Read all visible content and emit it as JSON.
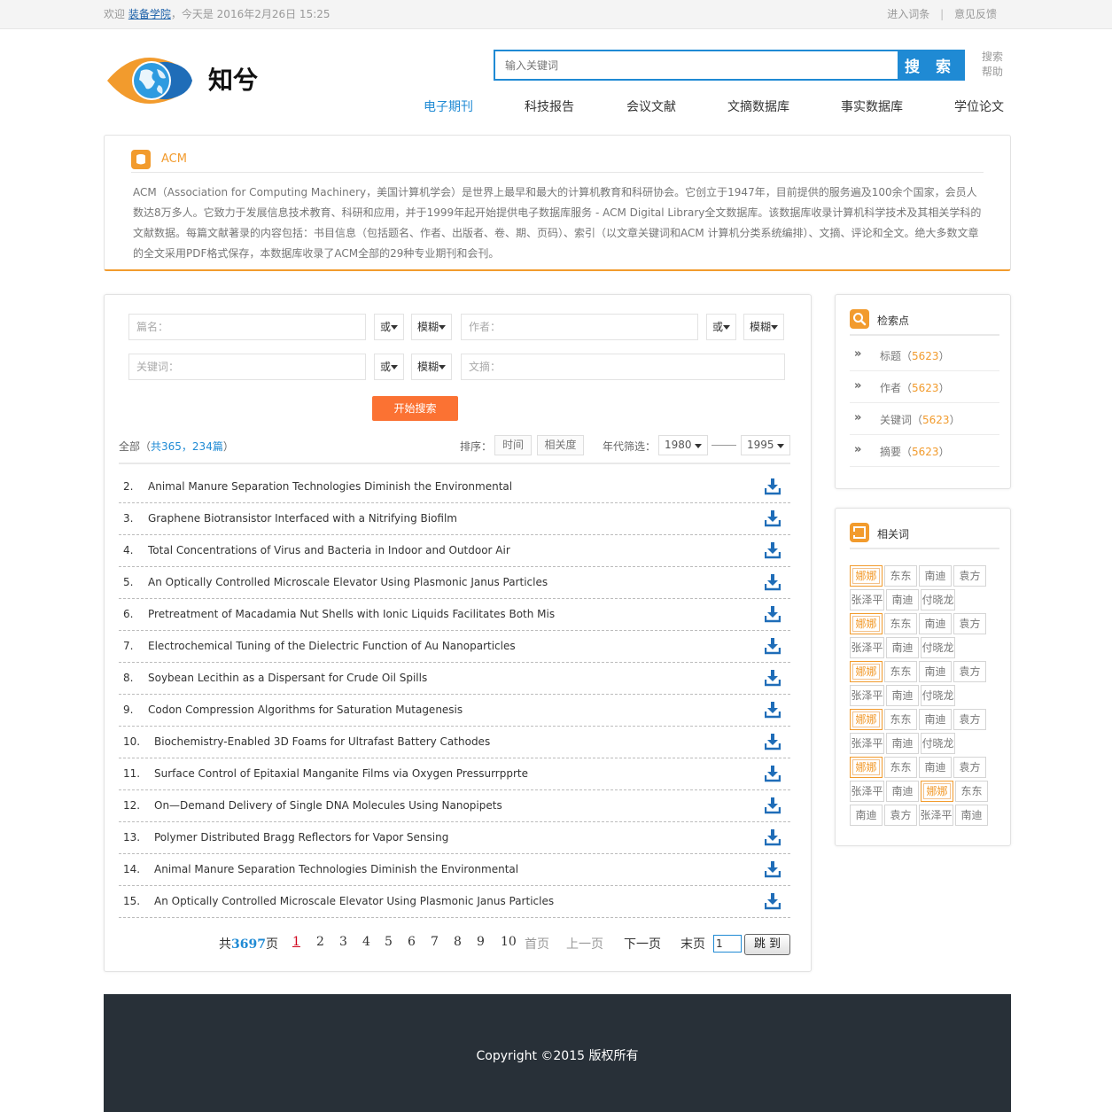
{
  "topbar": {
    "welcome_prefix": "欢迎",
    "org": "装备学院",
    "date_text": "，今天是 2016年2月26日  15:25",
    "login_link": "进入词条",
    "feedback_link": "意见反馈"
  },
  "header": {
    "logo_text": "知兮",
    "search_placeholder": "输入关键词",
    "search_button": "搜 索",
    "help_line1": "搜索",
    "help_line2": "帮助"
  },
  "nav": [
    "电子期刊",
    "科技报告",
    "会议文献",
    "文摘数据库",
    "事实数据库",
    "学位论文"
  ],
  "intro": {
    "name": "ACM",
    "description": "ACM（Association for Computing Machinery，美国计算机学会）是世界上最早和最大的计算机教育和科研协会。它创立于1947年，目前提供的服务遍及100余个国家，会员人数达8万多人。它致力于发展信息技术教育、科研和应用，并于1999年起开始提供电子数据库服务 - ACM Digital Library全文数据库。该数据库收录计算机科学技术及其相关学科的文献数据。每篇文献著录的内容包括：书目信息（包括题名、作者、出版者、卷、期、页码）、索引（以文章关键词和ACM 计算机分类系统编排）、文摘、评论和全文。绝大多数文章的全文采用PDF格式保存，本数据库收录了ACM全部的29种专业期刊和会刊。"
  },
  "search_form": {
    "title_ph": "篇名：",
    "author_ph": "作者：",
    "keyword_ph": "关键词：",
    "abstract_ph": "文摘：",
    "logic": "或",
    "match": "模糊",
    "start_button": "开始搜索"
  },
  "results": {
    "all_label": "全部（",
    "total": "共365，234篇",
    "all_close": "）",
    "sort_label": "排序：",
    "sort_time": "时间",
    "sort_relevance": "相关度",
    "year_label": "年代筛选：",
    "year_from": "1980",
    "year_to": "1995",
    "items": [
      {
        "num": "2.",
        "title": "Animal Manure Separation Technologies Diminish the Environmental"
      },
      {
        "num": "3.",
        "title": "Graphene Biotransistor Interfaced with a Nitrifying Biofilm"
      },
      {
        "num": "4.",
        "title": "Total Concentrations of Virus and Bacteria in Indoor and Outdoor Air"
      },
      {
        "num": "5.",
        "title": "An Optically Controlled Microscale Elevator Using Plasmonic Janus Particles"
      },
      {
        "num": "6.",
        "title": "Pretreatment of Macadamia Nut Shells with Ionic Liquids Facilitates Both Mis"
      },
      {
        "num": "7.",
        "title": "Electrochemical Tuning of the Dielectric Function of Au Nanoparticles"
      },
      {
        "num": "8.",
        "title": "Soybean Lecithin as a Dispersant for Crude Oil Spills"
      },
      {
        "num": "9.",
        "title": "Codon Compression Algorithms for Saturation Mutagenesis"
      },
      {
        "num": "10.",
        "title": "Biochemistry-Enabled 3D Foams for Ultrafast Battery Cathodes"
      },
      {
        "num": "11.",
        "title": "Surface Control of Epitaxial Manganite Films via Oxygen Pressurrpprte"
      },
      {
        "num": "12.",
        "title": "On—Demand Delivery of Single DNA Molecules Using Nanopipets"
      },
      {
        "num": "13.",
        "title": "Polymer Distributed Bragg Reflectors for Vapor Sensing"
      },
      {
        "num": "14.",
        "title": "Animal Manure Separation Technologies Diminish the Environmental"
      },
      {
        "num": "15.",
        "title": "An Optically Controlled Microscale Elevator Using Plasmonic Janus Particles"
      }
    ]
  },
  "pager": {
    "total_prefix": "共",
    "total_pages": "3697",
    "total_suffix": "页",
    "pages": [
      "1",
      "2",
      "3",
      "4",
      "5",
      "6",
      "7",
      "8",
      "9",
      "10"
    ],
    "first": "首页",
    "prev": "上一页",
    "next": "下一页",
    "last": "末页",
    "input_value": "1",
    "go": "跳 到"
  },
  "keypoints": {
    "title": "检索点",
    "items": [
      {
        "label": "标题",
        "count": "5623"
      },
      {
        "label": "作者",
        "count": "5623"
      },
      {
        "label": "关键词",
        "count": "5623"
      },
      {
        "label": "摘要",
        "count": "5623"
      }
    ]
  },
  "related": {
    "title": "相关词",
    "rows": [
      [
        "娜娜",
        "东东",
        "南迪",
        "袁方"
      ],
      [
        "张泽平",
        "南迪",
        "付晓龙"
      ],
      [
        "娜娜",
        "东东",
        "南迪",
        "袁方"
      ],
      [
        "张泽平",
        "南迪",
        "付晓龙"
      ],
      [
        "娜娜",
        "东东",
        "南迪",
        "袁方"
      ],
      [
        "张泽平",
        "南迪",
        "付晓龙"
      ],
      [
        "娜娜",
        "东东",
        "南迪",
        "袁方"
      ],
      [
        "张泽平",
        "南迪",
        "付晓龙"
      ],
      [
        "娜娜",
        "东东",
        "南迪",
        "袁方"
      ],
      [
        "张泽平",
        "南迪",
        "娜娜",
        "东东"
      ],
      [
        "南迪",
        "袁方",
        "张泽平",
        "南迪"
      ]
    ]
  },
  "footer": {
    "copyright": "Copyright ©2015  版权所有"
  },
  "colors": {
    "accent_blue": "#1f8ad4",
    "accent_orange": "#f29b2d",
    "button_orange": "#fb7233",
    "footer_bg": "#283038"
  }
}
